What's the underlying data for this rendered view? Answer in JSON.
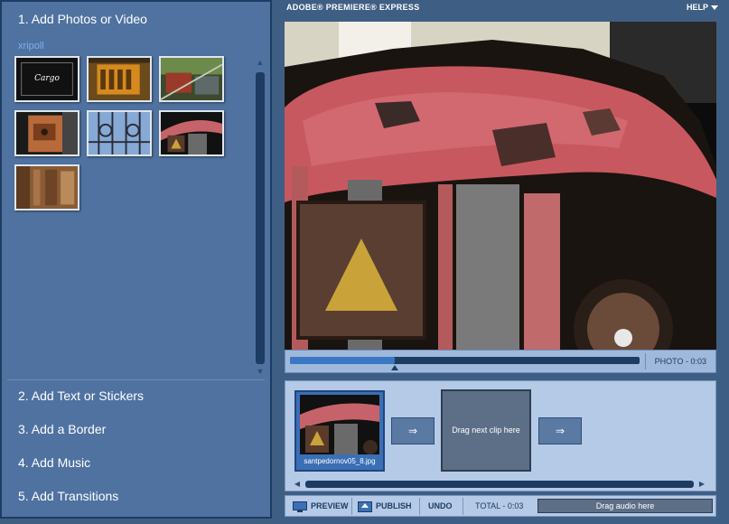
{
  "header": {
    "app_name": "ADOBE® PREMIERE® EXPRESS",
    "help_label": "HELP"
  },
  "steps": [
    {
      "label": "1. Add Photos or Video"
    },
    {
      "label": "2. Add Text or Stickers"
    },
    {
      "label": "3. Add a Border"
    },
    {
      "label": "4. Add Music"
    },
    {
      "label": "5. Add Transitions"
    }
  ],
  "library": {
    "owner": "xripoll",
    "thumbnails": [
      {
        "icon": "cargo-title-thumbnail",
        "text": "Cargo"
      },
      {
        "icon": "orange-tractor-grille-thumbnail"
      },
      {
        "icon": "machinery-thumbnail"
      },
      {
        "icon": "rusty-lock-thumbnail"
      },
      {
        "icon": "iron-gate-thumbnail"
      },
      {
        "icon": "red-tractor-thumbnail"
      },
      {
        "icon": "wooden-door-thumbnail"
      }
    ]
  },
  "player": {
    "label": "PHOTO - 0:03",
    "progress": 0.3
  },
  "timeline": {
    "clip": {
      "filename": "santpedornov05_8.jpg"
    },
    "transition_glyph": "⇒",
    "drop_clip_label": "Drag next clip here"
  },
  "toolbar": {
    "preview_label": "PREVIEW",
    "publish_label": "PUBLISH",
    "undo_label": "UNDO",
    "total_label": "TOTAL - 0:03",
    "audio_drop_label": "Drag audio here"
  }
}
